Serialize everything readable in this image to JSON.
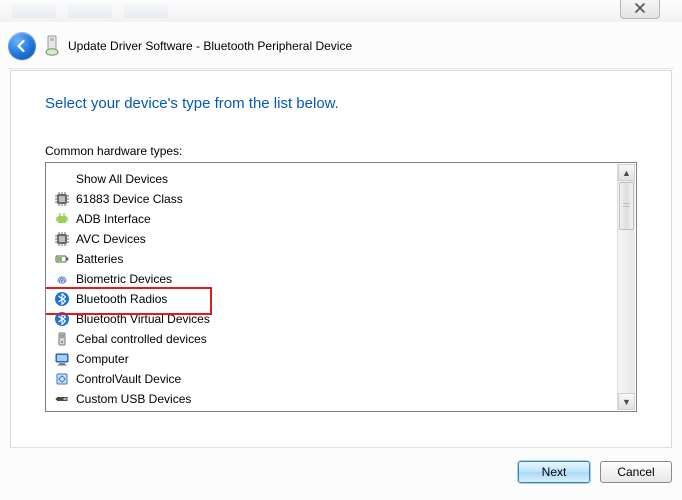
{
  "header": {
    "title": "Update Driver Software - Bluetooth Peripheral Device"
  },
  "panel": {
    "heading": "Select your device's type from the list below.",
    "list_label": "Common hardware types:"
  },
  "devices": [
    {
      "label": "Show All Devices",
      "icon": "none"
    },
    {
      "label": "61883 Device Class",
      "icon": "chip"
    },
    {
      "label": "ADB Interface",
      "icon": "android"
    },
    {
      "label": "AVC Devices",
      "icon": "chip"
    },
    {
      "label": "Batteries",
      "icon": "battery"
    },
    {
      "label": "Biometric Devices",
      "icon": "biometric"
    },
    {
      "label": "Bluetooth Radios",
      "icon": "bluetooth",
      "highlighted": true
    },
    {
      "label": "Bluetooth Virtual Devices",
      "icon": "bluetooth"
    },
    {
      "label": "Cebal controlled devices",
      "icon": "tower"
    },
    {
      "label": "Computer",
      "icon": "computer"
    },
    {
      "label": "ControlVault Device",
      "icon": "vault"
    },
    {
      "label": "Custom USB Devices",
      "icon": "usb"
    }
  ],
  "footer": {
    "next": "Next",
    "cancel": "Cancel"
  }
}
